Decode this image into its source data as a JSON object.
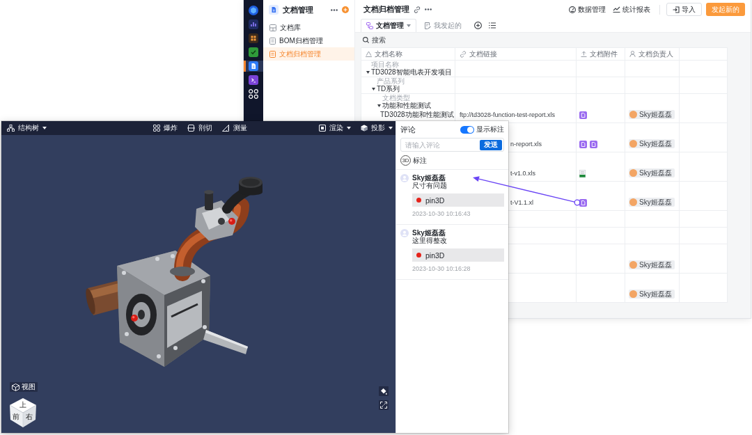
{
  "back_window": {
    "nav_rail": [
      {
        "selected": false
      },
      {
        "selected": false
      },
      {
        "selected": false
      },
      {
        "selected": false
      },
      {
        "selected": true
      },
      {
        "selected": false
      },
      {
        "selected": false
      }
    ],
    "sidebar": {
      "title": "文档管理",
      "items": [
        {
          "label": "文档库",
          "selected": false
        },
        {
          "label": "BOM归档管理",
          "selected": false
        },
        {
          "label": "文档归档管理",
          "selected": true
        }
      ]
    },
    "header": {
      "title": "文档归档管理",
      "links": [
        "数据管理",
        "统计报表"
      ],
      "buttons": [
        {
          "label": "导入",
          "kind": "secondary"
        },
        {
          "label": "发起新的",
          "kind": "primary"
        }
      ]
    },
    "tabs": [
      {
        "label": "文档管理",
        "selected": true
      },
      {
        "label": "我发起的",
        "selected": false
      }
    ],
    "search": {
      "placeholder": "搜索"
    },
    "table": {
      "columns": [
        "文档名称",
        "文档链接",
        "文档附件",
        "文档负责人"
      ],
      "rows": [
        {
          "caption": "项目名称",
          "title": "TD3028智能电表开发项目",
          "expanded": true,
          "children": [
            {
              "caption": "产品系列",
              "title": "TD系列",
              "expanded": true,
              "children": [
                {
                  "caption": "文档类型",
                  "title": "功能和性能测试",
                  "expanded": true,
                  "children": [
                    {
                      "name": "TD3028功能和性能测试",
                      "link": "ftp://td3028-function-test-report.xls",
                      "attachments": [
                        {
                          "kind": "archive"
                        }
                      ],
                      "owner": "Sky姬磊磊"
                    },
                    {
                      "link": "n-report.xls",
                      "attachments": [
                        {
                          "kind": "archive"
                        },
                        {
                          "kind": "archive"
                        }
                      ],
                      "owner": "Sky姬磊磊"
                    },
                    {
                      "link": "t-v1.0.xls",
                      "attachments": [
                        {
                          "kind": "sheet"
                        }
                      ],
                      "owner": "Sky姬磊磊"
                    },
                    {
                      "link": "t-V1.1.xl",
                      "attachments": [
                        {
                          "kind": "archive"
                        }
                      ],
                      "owner": "Sky姬磊磊"
                    }
                  ]
                }
              ]
            }
          ]
        },
        {
          "children": [
            {
              "children": [
                {
                  "children": [
                    {
                      "owner": "Sky姬磊磊"
                    },
                    {
                      "owner": "Sky姬磊磊"
                    }
                  ]
                }
              ]
            }
          ]
        }
      ]
    }
  },
  "viewer_window": {
    "toolbar": {
      "left": [
        {
          "label": "结构树",
          "kind": "menu"
        }
      ],
      "center": [
        {
          "label": "爆炸",
          "kind": "tool"
        },
        {
          "label": "剖切",
          "kind": "tool"
        },
        {
          "label": "测量",
          "kind": "tool"
        }
      ],
      "right": [
        {
          "label": "渲染",
          "kind": "menu"
        },
        {
          "label": "投影",
          "kind": "menu"
        }
      ]
    },
    "view_button": {
      "label": "视图"
    },
    "view_cube": {
      "faces": [
        "上",
        "前",
        "右"
      ]
    },
    "comments_panel": {
      "title": "评论",
      "show_annotations": {
        "label": "显示标注",
        "on": true
      },
      "input": {
        "placeholder": "请输入评论"
      },
      "send_button": "发送",
      "annotate_button": {
        "badge": "3D",
        "label": "标注"
      },
      "comments": [
        {
          "author": "Sky姬磊磊",
          "text": "尺寸有问题",
          "pin": "pin3D",
          "time": "2023-10-30 10:16:43"
        },
        {
          "author": "Sky姬磊磊",
          "text": "这里得整改",
          "pin": "pin3D",
          "time": "2023-10-30 10:16:28"
        }
      ]
    }
  }
}
